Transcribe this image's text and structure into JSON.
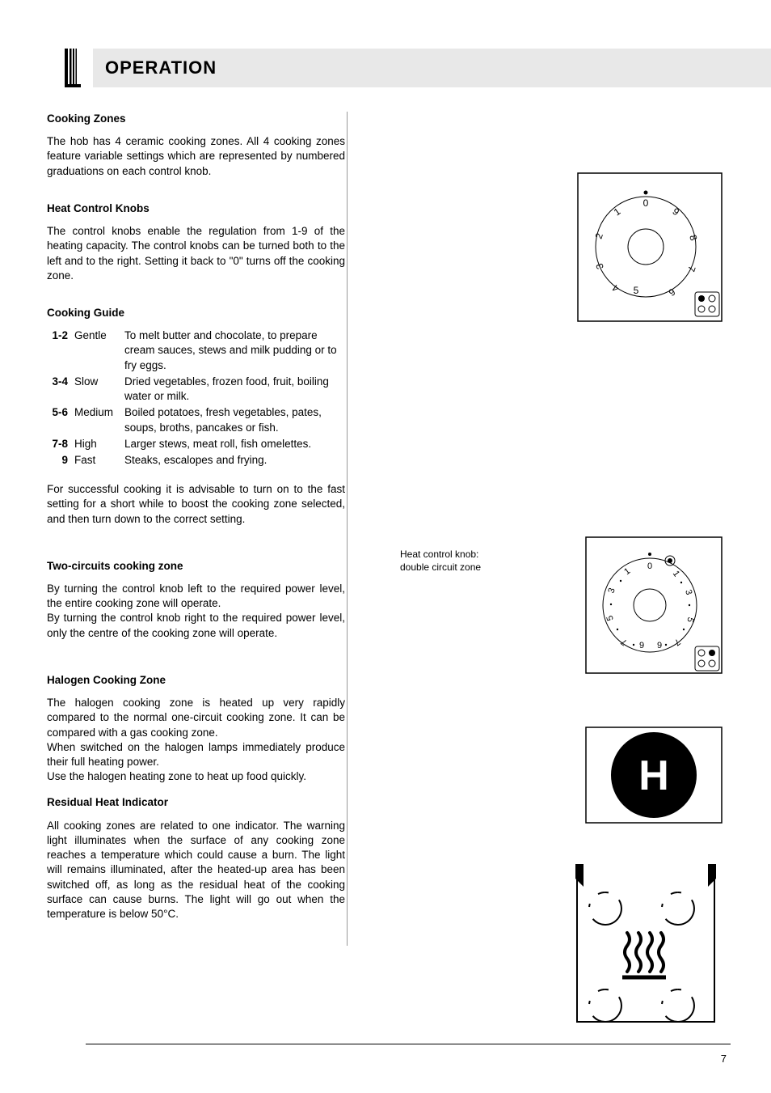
{
  "title": "OPERATION",
  "page_number": "7",
  "sections": {
    "cooking_zones": {
      "heading": "Cooking Zones",
      "body": "The hob has 4 ceramic cooking zones. All 4 cooking zones feature variable settings which are represented by numbered graduations on each control knob."
    },
    "heat_control": {
      "heading": "Heat Control Knobs",
      "body": "The control knobs enable the regulation from 1-9 of the heating capacity. The control knobs can be turned both to the left and to the right. Setting it back to \"0\" turns off the cooking zone."
    },
    "cooking_guide": {
      "heading": "Cooking Guide",
      "rows": [
        {
          "num": "1-2",
          "label": "Gentle",
          "desc": "To melt butter and chocolate, to prepare cream sauces, stews and milk pudding or to fry eggs."
        },
        {
          "num": "3-4",
          "label": "Slow",
          "desc": "Dried vegetables, frozen food, fruit, boiling water or milk."
        },
        {
          "num": "5-6",
          "label": "Medium",
          "desc": "Boiled potatoes, fresh vegetables, pates, soups, broths, pancakes or fish."
        },
        {
          "num": "7-8",
          "label": "High",
          "desc": "Larger stews, meat roll, fish omelettes."
        },
        {
          "num": "9",
          "label": "Fast",
          "desc": "Steaks, escalopes and frying."
        }
      ],
      "footer": "For successful cooking it is advisable to turn on to the fast setting for a short while to boost the  cooking zone selected, and then turn down to the correct setting."
    },
    "two_circuits": {
      "heading": "Two-circuits cooking zone",
      "p1": "By turning the control knob left to the required power level, the entire cooking zone will operate.",
      "p2": "By turning the control knob right to the required power level, only the centre of the cooking zone will operate."
    },
    "halogen": {
      "heading": "Halogen Cooking Zone",
      "p1": "The halogen cooking zone is heated up very rapidly compared to the normal one-circuit cooking zone. It can be compared with a gas cooking zone.",
      "p2": "When switched on the halogen lamps immediately produce their full heating power.",
      "p3": "Use the halogen heating zone to heat up food quickly."
    },
    "residual": {
      "heading": "Residual Heat Indicator",
      "body": "All cooking zones are related to one indicator. The warning light illuminates when the surface of any cooking zone reaches a temperature which could cause a burn. The light will remains illuminated, after the heated-up area has been switched off, as long as the residual heat of the cooking surface can cause burns. The light will go out when the temperature is below 50°C."
    }
  },
  "figure_caption": {
    "line1": "Heat control knob:",
    "line2": "double circuit zone"
  },
  "halogen_letter": "H"
}
